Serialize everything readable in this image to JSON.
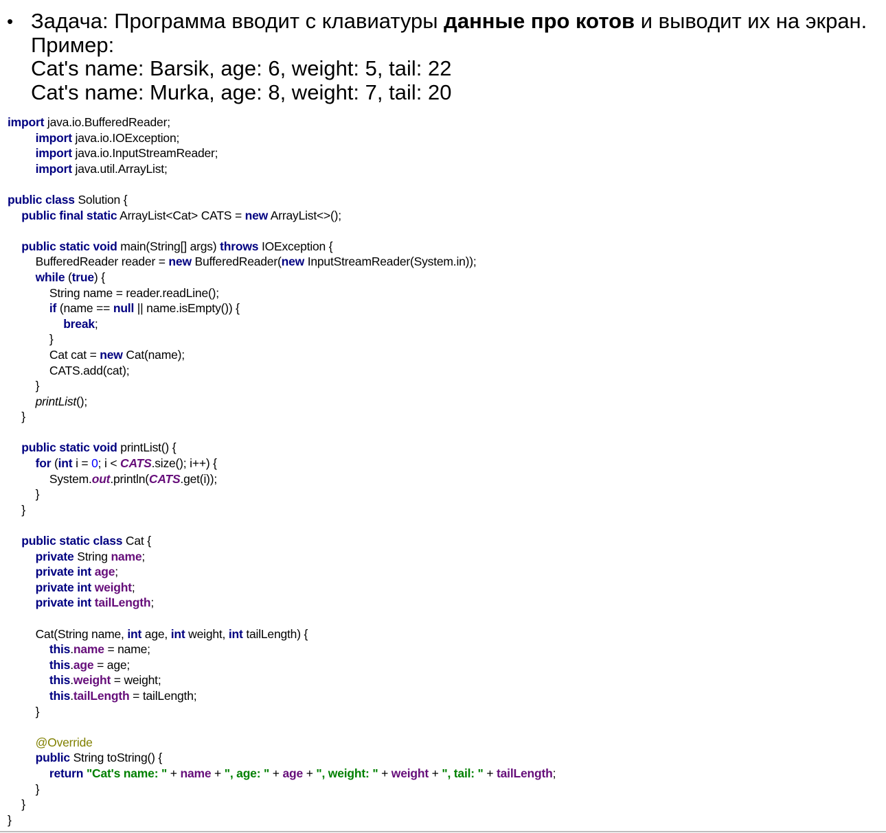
{
  "task": {
    "bullet": "•",
    "lines": [
      [
        {
          "t": "Задача: Программа вводит с клавиатуры ",
          "bold": false
        },
        {
          "t": "данные про котов",
          "bold": true
        },
        {
          "t": " и выводит их на экран.",
          "bold": false
        }
      ],
      [
        {
          "t": "Пример:",
          "bold": false
        }
      ],
      [
        {
          "t": "Cat's name: Barsik, age: 6, weight: 5, tail: 22",
          "bold": false
        }
      ],
      [
        {
          "t": "Cat's name: Murka, age: 8, weight: 7, tail: 20",
          "bold": false
        }
      ]
    ]
  },
  "code": {
    "lines": [
      {
        "indent": 0,
        "tokens": [
          [
            "kw",
            "import"
          ],
          [
            "plain",
            " java.io.BufferedReader;"
          ]
        ]
      },
      {
        "indent": 2,
        "tokens": [
          [
            "kw",
            "import"
          ],
          [
            "plain",
            " java.io.IOException;"
          ]
        ]
      },
      {
        "indent": 2,
        "tokens": [
          [
            "kw",
            "import"
          ],
          [
            "plain",
            " java.io.InputStreamReader;"
          ]
        ]
      },
      {
        "indent": 2,
        "tokens": [
          [
            "kw",
            "import"
          ],
          [
            "plain",
            " java.util.ArrayList;"
          ]
        ]
      },
      {
        "indent": 0,
        "tokens": []
      },
      {
        "indent": 0,
        "tokens": [
          [
            "kw",
            "public class"
          ],
          [
            "plain",
            " Solution {"
          ]
        ]
      },
      {
        "indent": 1,
        "tokens": [
          [
            "kw",
            "public final static"
          ],
          [
            "plain",
            " ArrayList<Cat> CATS = "
          ],
          [
            "kw",
            "new"
          ],
          [
            "plain",
            " ArrayList<>();"
          ]
        ]
      },
      {
        "indent": 0,
        "tokens": []
      },
      {
        "indent": 1,
        "tokens": [
          [
            "kw",
            "public static void"
          ],
          [
            "plain",
            " main(String[] args) "
          ],
          [
            "kw",
            "throws"
          ],
          [
            "plain",
            " IOException {"
          ]
        ]
      },
      {
        "indent": 2,
        "tokens": [
          [
            "plain",
            "BufferedReader reader = "
          ],
          [
            "kw",
            "new"
          ],
          [
            "plain",
            " BufferedReader("
          ],
          [
            "kw",
            "new"
          ],
          [
            "plain",
            " InputStreamReader(System.in));"
          ]
        ]
      },
      {
        "indent": 2,
        "tokens": [
          [
            "kw",
            "while"
          ],
          [
            "plain",
            " ("
          ],
          [
            "kw",
            "true"
          ],
          [
            "plain",
            ") {"
          ]
        ]
      },
      {
        "indent": 3,
        "tokens": [
          [
            "plain",
            "String name = reader.readLine();"
          ]
        ]
      },
      {
        "indent": 3,
        "tokens": [
          [
            "kw",
            "if"
          ],
          [
            "plain",
            " (name == "
          ],
          [
            "kw",
            "null"
          ],
          [
            "plain",
            " || name.isEmpty()) {"
          ]
        ]
      },
      {
        "indent": 4,
        "tokens": [
          [
            "kw",
            "break"
          ],
          [
            "plain",
            ";"
          ]
        ]
      },
      {
        "indent": 3,
        "tokens": [
          [
            "plain",
            "}"
          ]
        ]
      },
      {
        "indent": 3,
        "tokens": [
          [
            "plain",
            "Cat cat = "
          ],
          [
            "kw",
            "new"
          ],
          [
            "plain",
            " Cat(name);"
          ]
        ]
      },
      {
        "indent": 3,
        "tokens": [
          [
            "plain",
            "CATS.add(cat);"
          ]
        ]
      },
      {
        "indent": 2,
        "tokens": [
          [
            "plain",
            "}"
          ]
        ]
      },
      {
        "indent": 2,
        "tokens": [
          [
            "italic-call",
            "printList"
          ],
          [
            "plain",
            "();"
          ]
        ]
      },
      {
        "indent": 1,
        "tokens": [
          [
            "plain",
            "}"
          ]
        ]
      },
      {
        "indent": 0,
        "tokens": []
      },
      {
        "indent": 1,
        "tokens": [
          [
            "kw",
            "public static void"
          ],
          [
            "plain",
            " printList() {"
          ]
        ]
      },
      {
        "indent": 2,
        "tokens": [
          [
            "kw",
            "for"
          ],
          [
            "plain",
            " ("
          ],
          [
            "kw",
            "int"
          ],
          [
            "plain",
            " i = "
          ],
          [
            "num",
            "0"
          ],
          [
            "plain",
            "; i < "
          ],
          [
            "static-field",
            "CATS"
          ],
          [
            "plain",
            ".size(); i++) {"
          ]
        ]
      },
      {
        "indent": 3,
        "tokens": [
          [
            "plain",
            "System."
          ],
          [
            "static-field",
            "out"
          ],
          [
            "plain",
            ".println("
          ],
          [
            "static-field",
            "CATS"
          ],
          [
            "plain",
            ".get(i));"
          ]
        ]
      },
      {
        "indent": 2,
        "tokens": [
          [
            "plain",
            "}"
          ]
        ]
      },
      {
        "indent": 1,
        "tokens": [
          [
            "plain",
            "}"
          ]
        ]
      },
      {
        "indent": 0,
        "tokens": []
      },
      {
        "indent": 1,
        "tokens": [
          [
            "kw",
            "public static class"
          ],
          [
            "plain",
            " Cat {"
          ]
        ]
      },
      {
        "indent": 2,
        "tokens": [
          [
            "kw",
            "private"
          ],
          [
            "plain",
            " String "
          ],
          [
            "field",
            "name"
          ],
          [
            "plain",
            ";"
          ]
        ]
      },
      {
        "indent": 2,
        "tokens": [
          [
            "kw",
            "private int"
          ],
          [
            "plain",
            " "
          ],
          [
            "field",
            "age"
          ],
          [
            "plain",
            ";"
          ]
        ]
      },
      {
        "indent": 2,
        "tokens": [
          [
            "kw",
            "private int"
          ],
          [
            "plain",
            " "
          ],
          [
            "field",
            "weight"
          ],
          [
            "plain",
            ";"
          ]
        ]
      },
      {
        "indent": 2,
        "tokens": [
          [
            "kw",
            "private int"
          ],
          [
            "plain",
            " "
          ],
          [
            "field",
            "tailLength"
          ],
          [
            "plain",
            ";"
          ]
        ]
      },
      {
        "indent": 0,
        "tokens": []
      },
      {
        "indent": 2,
        "tokens": [
          [
            "plain",
            "Cat(String name, "
          ],
          [
            "kw",
            "int"
          ],
          [
            "plain",
            " age, "
          ],
          [
            "kw",
            "int"
          ],
          [
            "plain",
            " weight, "
          ],
          [
            "kw",
            "int"
          ],
          [
            "plain",
            " tailLength) {"
          ]
        ]
      },
      {
        "indent": 3,
        "tokens": [
          [
            "kw",
            "this"
          ],
          [
            "plain",
            "."
          ],
          [
            "field",
            "name"
          ],
          [
            "plain",
            " = name;"
          ]
        ]
      },
      {
        "indent": 3,
        "tokens": [
          [
            "kw",
            "this"
          ],
          [
            "plain",
            "."
          ],
          [
            "field",
            "age"
          ],
          [
            "plain",
            " = age;"
          ]
        ]
      },
      {
        "indent": 3,
        "tokens": [
          [
            "kw",
            "this"
          ],
          [
            "plain",
            "."
          ],
          [
            "field",
            "weight"
          ],
          [
            "plain",
            " = weight;"
          ]
        ]
      },
      {
        "indent": 3,
        "tokens": [
          [
            "kw",
            "this"
          ],
          [
            "plain",
            "."
          ],
          [
            "field",
            "tailLength"
          ],
          [
            "plain",
            " = tailLength;"
          ]
        ]
      },
      {
        "indent": 2,
        "tokens": [
          [
            "plain",
            "}"
          ]
        ]
      },
      {
        "indent": 0,
        "tokens": []
      },
      {
        "indent": 2,
        "tokens": [
          [
            "ann",
            "@Override"
          ]
        ]
      },
      {
        "indent": 2,
        "tokens": [
          [
            "kw",
            "public"
          ],
          [
            "plain",
            " String toString() {"
          ]
        ]
      },
      {
        "indent": 3,
        "tokens": [
          [
            "kw",
            "return"
          ],
          [
            "plain",
            " "
          ],
          [
            "str",
            "\"Cat's name: \""
          ],
          [
            "plain",
            " + "
          ],
          [
            "field",
            "name"
          ],
          [
            "plain",
            " + "
          ],
          [
            "str",
            "\", age: \""
          ],
          [
            "plain",
            " + "
          ],
          [
            "field",
            "age"
          ],
          [
            "plain",
            " + "
          ],
          [
            "str",
            "\", weight: \""
          ],
          [
            "plain",
            " + "
          ],
          [
            "field",
            "weight"
          ],
          [
            "plain",
            " + "
          ],
          [
            "str",
            "\", tail: \""
          ],
          [
            "plain",
            " + "
          ],
          [
            "field",
            "tailLength"
          ],
          [
            "plain",
            ";"
          ]
        ]
      },
      {
        "indent": 2,
        "tokens": [
          [
            "plain",
            "}"
          ]
        ]
      },
      {
        "indent": 1,
        "tokens": [
          [
            "plain",
            "}"
          ]
        ]
      },
      {
        "indent": 0,
        "tokens": [
          [
            "plain",
            "}"
          ]
        ]
      }
    ]
  },
  "colors": {
    "keyword": "#000080",
    "field": "#660e7a",
    "string": "#008000",
    "number": "#0000ff",
    "annotation": "#808000"
  }
}
